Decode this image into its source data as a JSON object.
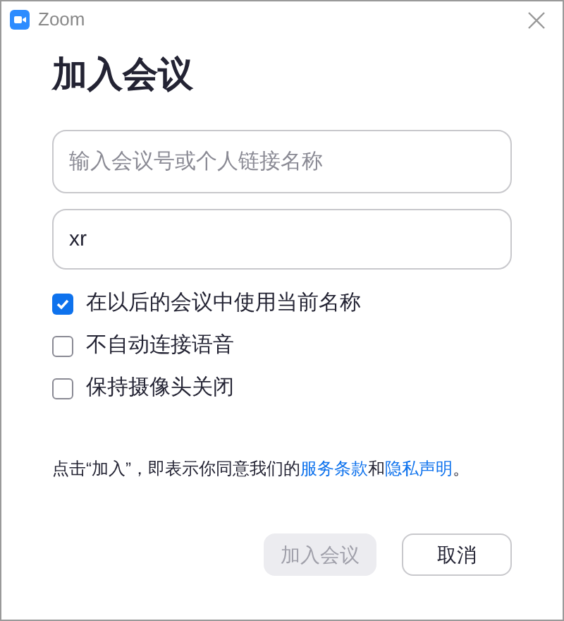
{
  "window": {
    "title": "Zoom"
  },
  "heading": "加入会议",
  "meeting_field": {
    "placeholder": "输入会议号或个人链接名称"
  },
  "name_field": {
    "value": "xr"
  },
  "options": [
    {
      "label": "在以后的会议中使用当前名称",
      "checked": true
    },
    {
      "label": "不自动连接语音",
      "checked": false
    },
    {
      "label": "保持摄像头关闭",
      "checked": false
    }
  ],
  "terms": {
    "text": "点击“加入”，即表示你同意我们的",
    "link_1": "服务条款",
    "joiner": "和",
    "link_2": "隐私声明",
    "end": "。"
  },
  "buttons": [
    {
      "label": "加入会议",
      "kind": "primary",
      "disabled": true
    },
    {
      "label": "取消",
      "kind": "secondary",
      "disabled": false
    }
  ]
}
